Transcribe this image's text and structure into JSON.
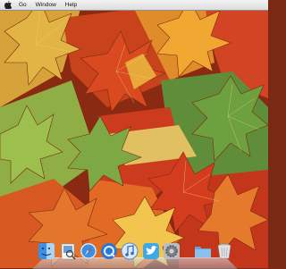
{
  "menubar": {
    "apple_menu": "apple-logo",
    "items": [
      {
        "label": "Go"
      },
      {
        "label": "Window"
      },
      {
        "label": "Help"
      }
    ]
  },
  "dock": {
    "items": [
      {
        "icon": "finder-icon"
      },
      {
        "icon": "preview-icon"
      },
      {
        "icon": "safari-icon"
      },
      {
        "icon": "quicktime-icon"
      },
      {
        "icon": "itunes-icon"
      },
      {
        "icon": "twitter-icon"
      },
      {
        "icon": "system-preferences-icon"
      },
      {
        "icon": "folder-icon"
      },
      {
        "icon": "trash-icon"
      }
    ]
  },
  "colors": {
    "menubar": "#e8e8e8",
    "wallpaper_red": "#c8321a",
    "wallpaper_orange": "#e88a1a",
    "wallpaper_yellow": "#e8c83a",
    "wallpaper_green": "#6a9a3a"
  }
}
